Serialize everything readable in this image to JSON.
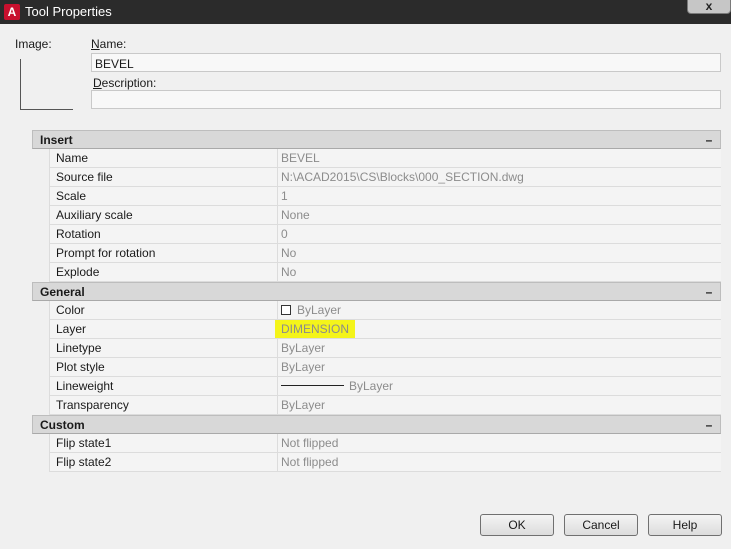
{
  "window": {
    "title": "Tool Properties",
    "close_label": "x"
  },
  "image_label": "Image:",
  "name": {
    "label_prefix": "N",
    "label_rest": "ame:",
    "value": "BEVEL"
  },
  "description": {
    "label_prefix": "D",
    "label_rest": "escription:",
    "value": ""
  },
  "sections": {
    "insert": {
      "title": "Insert",
      "toggle": "–",
      "rows": [
        {
          "key": "Name",
          "value": "BEVEL"
        },
        {
          "key": "Source file",
          "value": "N:\\ACAD2015\\CS\\Blocks\\000_SECTION.dwg"
        },
        {
          "key": "Scale",
          "value": "1"
        },
        {
          "key": "Auxiliary scale",
          "value": "None"
        },
        {
          "key": "Rotation",
          "value": "0"
        },
        {
          "key": "Prompt for rotation",
          "value": "No"
        },
        {
          "key": "Explode",
          "value": "No"
        }
      ]
    },
    "general": {
      "title": "General",
      "toggle": "–",
      "rows": [
        {
          "key": "Color",
          "value": "ByLayer"
        },
        {
          "key": "Layer",
          "value": "DIMENSION"
        },
        {
          "key": "Linetype",
          "value": "ByLayer"
        },
        {
          "key": "Plot style",
          "value": "ByLayer"
        },
        {
          "key": "Lineweight",
          "value": "ByLayer"
        },
        {
          "key": "Transparency",
          "value": "ByLayer"
        }
      ]
    },
    "custom": {
      "title": "Custom",
      "toggle": "–",
      "rows": [
        {
          "key": "Flip state1",
          "value": "Not flipped"
        },
        {
          "key": "Flip state2",
          "value": "Not flipped"
        }
      ]
    }
  },
  "buttons": {
    "ok": "OK",
    "cancel": "Cancel",
    "help": "Help"
  },
  "colors": {
    "highlight": "#f4f41a",
    "titlebar": "#2b2b2b",
    "app_icon": "#c8102e"
  },
  "icons": {
    "app": "autocad-logo-icon",
    "close": "close-icon",
    "color_swatch": "color-swatch-icon"
  }
}
